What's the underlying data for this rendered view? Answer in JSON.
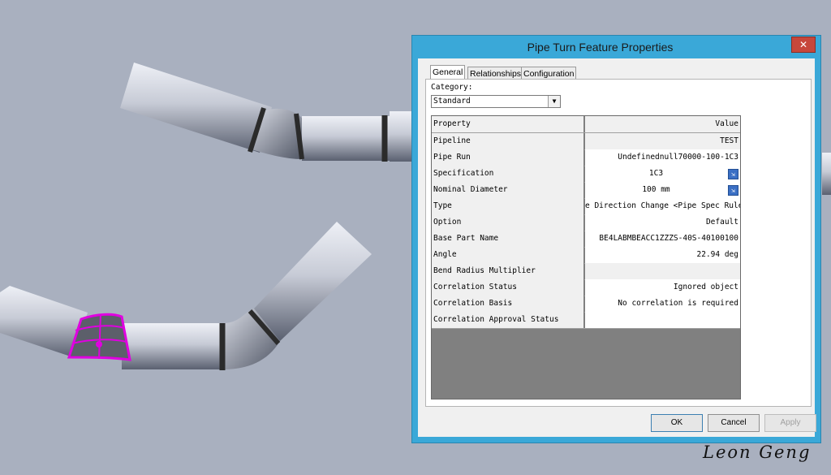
{
  "dialog": {
    "title": "Pipe Turn Feature Properties",
    "close_glyph": "✕",
    "tabs": [
      {
        "label": "General",
        "active": true
      },
      {
        "label": "Relationships",
        "active": false
      },
      {
        "label": "Configuration",
        "active": false
      }
    ],
    "category": {
      "label": "Category:",
      "value": "Standard"
    },
    "grid": {
      "header": {
        "property": "Property",
        "value": "Value"
      },
      "rows": [
        {
          "property": "Pipeline",
          "value": "TEST"
        },
        {
          "property": "Pipe Run",
          "value": "Undefinednull70000-100-1C3"
        },
        {
          "property": "Specification",
          "value": "1C3",
          "icon": "pick-icon"
        },
        {
          "property": "Nominal Diameter",
          "value": "100 mm",
          "icon": "pick-icon"
        },
        {
          "property": "Type",
          "value": "e Direction Change <Pipe Spec Rule>"
        },
        {
          "property": "Option",
          "value": "Default"
        },
        {
          "property": "Base Part Name",
          "value": "BE4LABMBEACC1ZZZS-40S-40100100"
        },
        {
          "property": "Angle",
          "value": "22.94 deg"
        },
        {
          "property": "Bend Radius Multiplier",
          "value": ""
        },
        {
          "property": "Correlation Status",
          "value": "Ignored object"
        },
        {
          "property": "Correlation Basis",
          "value": "No correlation is required"
        },
        {
          "property": "Correlation Approval Status",
          "value": ""
        }
      ]
    },
    "buttons": {
      "ok": "OK",
      "cancel": "Cancel",
      "apply": "Apply"
    }
  },
  "watermark": "Leon Geng",
  "colors": {
    "viewport_bg": "#a9b0bf",
    "selection_highlight": "#e000e0",
    "dialog_frame": "#3aa8d8"
  }
}
